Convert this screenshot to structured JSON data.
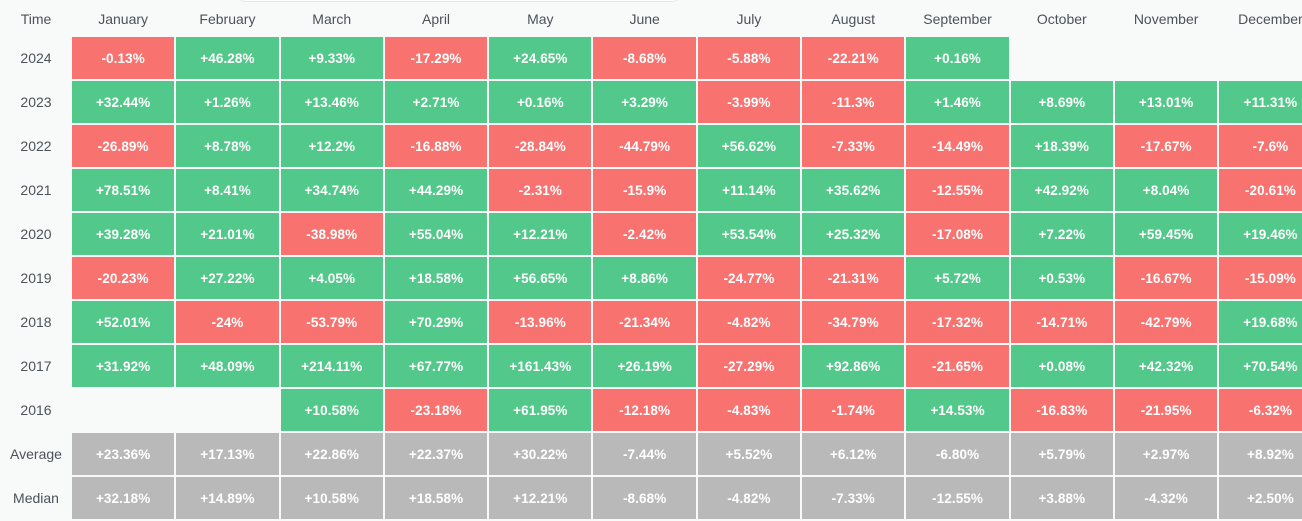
{
  "table": {
    "time_header": "Time",
    "months": [
      "January",
      "February",
      "March",
      "April",
      "May",
      "June",
      "July",
      "August",
      "September",
      "October",
      "November",
      "December"
    ],
    "rows": [
      {
        "label": "2024",
        "kind": "year",
        "values": [
          "-0.13%",
          "+46.28%",
          "+9.33%",
          "-17.29%",
          "+24.65%",
          "-8.68%",
          "-5.88%",
          "-22.21%",
          "+0.16%",
          "",
          "",
          ""
        ]
      },
      {
        "label": "2023",
        "kind": "year",
        "values": [
          "+32.44%",
          "+1.26%",
          "+13.46%",
          "+2.71%",
          "+0.16%",
          "+3.29%",
          "-3.99%",
          "-11.3%",
          "+1.46%",
          "+8.69%",
          "+13.01%",
          "+11.31%"
        ]
      },
      {
        "label": "2022",
        "kind": "year",
        "values": [
          "-26.89%",
          "+8.78%",
          "+12.2%",
          "-16.88%",
          "-28.84%",
          "-44.79%",
          "+56.62%",
          "-7.33%",
          "-14.49%",
          "+18.39%",
          "-17.67%",
          "-7.6%"
        ]
      },
      {
        "label": "2021",
        "kind": "year",
        "values": [
          "+78.51%",
          "+8.41%",
          "+34.74%",
          "+44.29%",
          "-2.31%",
          "-15.9%",
          "+11.14%",
          "+35.62%",
          "-12.55%",
          "+42.92%",
          "+8.04%",
          "-20.61%"
        ]
      },
      {
        "label": "2020",
        "kind": "year",
        "values": [
          "+39.28%",
          "+21.01%",
          "-38.98%",
          "+55.04%",
          "+12.21%",
          "-2.42%",
          "+53.54%",
          "+25.32%",
          "-17.08%",
          "+7.22%",
          "+59.45%",
          "+19.46%"
        ]
      },
      {
        "label": "2019",
        "kind": "year",
        "values": [
          "-20.23%",
          "+27.22%",
          "+4.05%",
          "+18.58%",
          "+56.65%",
          "+8.86%",
          "-24.77%",
          "-21.31%",
          "+5.72%",
          "+0.53%",
          "-16.67%",
          "-15.09%"
        ]
      },
      {
        "label": "2018",
        "kind": "year",
        "values": [
          "+52.01%",
          "-24%",
          "-53.79%",
          "+70.29%",
          "-13.96%",
          "-21.34%",
          "-4.82%",
          "-34.79%",
          "-17.32%",
          "-14.71%",
          "-42.79%",
          "+19.68%"
        ]
      },
      {
        "label": "2017",
        "kind": "year",
        "values": [
          "+31.92%",
          "+48.09%",
          "+214.11%",
          "+67.77%",
          "+161.43%",
          "+26.19%",
          "-27.29%",
          "+92.86%",
          "-21.65%",
          "+0.08%",
          "+42.32%",
          "+70.54%"
        ]
      },
      {
        "label": "2016",
        "kind": "year",
        "values": [
          "",
          "",
          "+10.58%",
          "-23.18%",
          "+61.95%",
          "-12.18%",
          "-4.83%",
          "-1.74%",
          "+14.53%",
          "-16.83%",
          "-21.95%",
          "-6.32%"
        ]
      },
      {
        "label": "Average",
        "kind": "stat",
        "values": [
          "+23.36%",
          "+17.13%",
          "+22.86%",
          "+22.37%",
          "+30.22%",
          "-7.44%",
          "+5.52%",
          "+6.12%",
          "-6.80%",
          "+5.79%",
          "+2.97%",
          "+8.92%"
        ]
      },
      {
        "label": "Median",
        "kind": "stat",
        "values": [
          "+32.18%",
          "+14.89%",
          "+10.58%",
          "+18.58%",
          "+12.21%",
          "-8.68%",
          "-4.82%",
          "-7.33%",
          "-12.55%",
          "+3.88%",
          "-4.32%",
          "+2.50%"
        ]
      }
    ]
  },
  "colors": {
    "positive": "#52c98a",
    "negative": "#f87270",
    "stat": "#b9b9b9",
    "background": "#f8f9f9",
    "text_label": "#4b5358",
    "cell_text": "#ffffff"
  }
}
